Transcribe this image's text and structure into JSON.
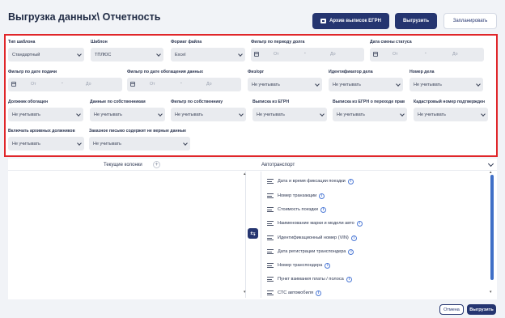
{
  "page": {
    "title": "Выгрузка данных\\ Отчетность"
  },
  "toolbar": {
    "egrn_label": "Архив выписок ЕГРН",
    "export_label": "Выгрузить",
    "schedule_label": "Запланировать"
  },
  "filters": {
    "template_type": {
      "label": "Тип шаблона",
      "value": "Стандартный"
    },
    "template": {
      "label": "Шаблон",
      "value": "ТПЛЮС"
    },
    "file_format": {
      "label": "Формат файла",
      "value": "Excel"
    },
    "period_filter": {
      "label": "Фильтр по периоду долга",
      "from": "От",
      "to": "До"
    },
    "status_date": {
      "label": "Дата смены статуса",
      "from": "От",
      "to": "До"
    },
    "filing_date": {
      "label": "Фильтр по дате подачи",
      "from": "От",
      "to": "До"
    },
    "appeal_date": {
      "label": "Фильтр по дате обогащения данных",
      "from": "От",
      "to": "До"
    },
    "person_type": {
      "label": "Физ/орг",
      "value": "Не учитывать"
    },
    "case_id": {
      "label": "Идентификатор дела",
      "value": "Не учитывать"
    },
    "case_number": {
      "label": "Номер дела",
      "value": "Не учитывать"
    },
    "debtor_enrich": {
      "label": "Должник обогащен",
      "value": "Не учитывать"
    },
    "owner_data": {
      "label": "Данные по собственникам",
      "value": "Не учитывать"
    },
    "owner_filter": {
      "label": "Фильтр по собственнику",
      "value": "Не учитывать"
    },
    "egrn_extract": {
      "label": "Выписка из ЕГРН",
      "value": "Не учитывать"
    },
    "egrn_transfer": {
      "label": "Выписка из ЕГРН о переходе прав",
      "value": "Не учитывать"
    },
    "cadastral": {
      "label": "Кадастровый номер подтвержден",
      "value": "Не учитывать"
    },
    "archive_debtors": {
      "label": "Включать архивных должников",
      "value": "Не учитывать"
    },
    "wrong_data": {
      "label": "Заказное письмо содержит не верные данные",
      "value": "Не учитывать"
    }
  },
  "columns_panel": {
    "current_label": "Текущие колонки",
    "add_symbol": "+",
    "group_label": "Автотранспорт",
    "swap_symbol": "⇆",
    "items": [
      "Дата и время фиксации поездки",
      "Номер транзакции",
      "Стоимость поездки",
      "Наименование марки и модели авто",
      "Идентификационный номер (VIN)",
      "Дата регистрации транспондера",
      "Номер транспондера",
      "Пункт взимания платы / полоса",
      "СТС автомобиля"
    ],
    "info_symbol": "i"
  },
  "footer": {
    "cancel_label": "Отмена",
    "export_label": "Выгрузить"
  },
  "colors": {
    "accent": "#253570",
    "highlight_border": "#e0262a",
    "scrollbar": "#3f6fc7"
  }
}
